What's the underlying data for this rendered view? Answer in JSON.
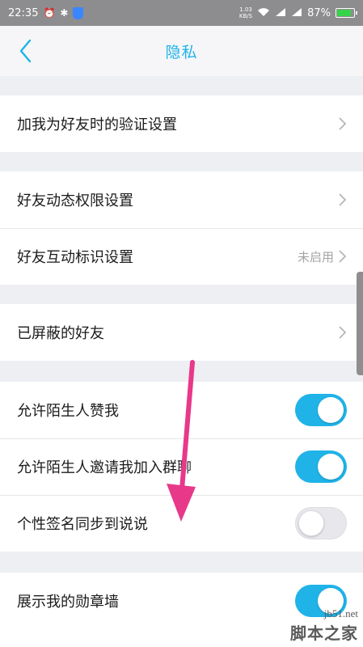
{
  "status_bar": {
    "time": "22:35",
    "net_speed_value": "1.03",
    "net_speed_unit": "KB/S",
    "battery": "87%",
    "battery_level": 0.87
  },
  "header": {
    "title": "隐私",
    "back_icon": "chevron-left-icon"
  },
  "groups": {
    "verify": {
      "label": "加我为好友时的验证设置"
    },
    "moments": {
      "label": "好友动态权限设置"
    },
    "interaction": {
      "label": "好友互动标识设置",
      "value": "未启用"
    },
    "blocked": {
      "label": "已屏蔽的好友"
    },
    "stranger_like": {
      "label": "允许陌生人赞我",
      "on": true
    },
    "stranger_invite": {
      "label": "允许陌生人邀请我加入群聊",
      "on": true
    },
    "signature_sync": {
      "label": "个性签名同步到说说",
      "on": false
    },
    "medal_wall": {
      "label": "展示我的勋章墙",
      "on": true
    }
  },
  "watermark": {
    "url": "jb51.net",
    "name": "脚本之家"
  },
  "colors": {
    "accent": "#1fb3e8",
    "annotation_arrow": "#e8388a"
  }
}
